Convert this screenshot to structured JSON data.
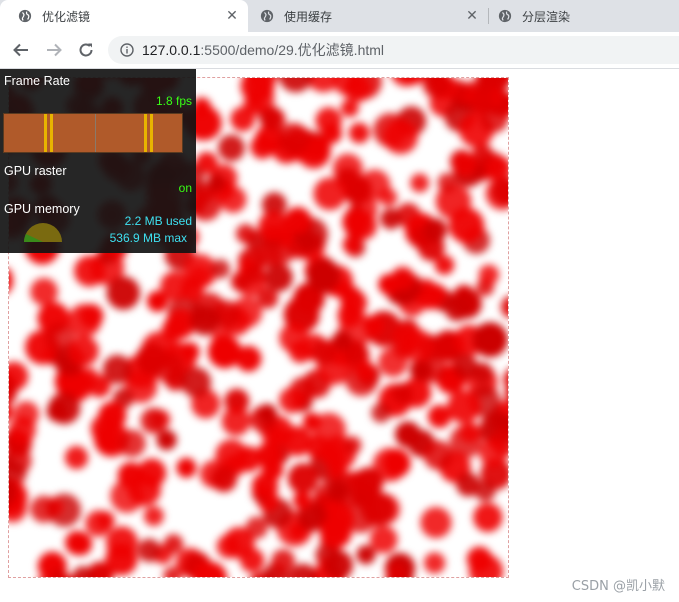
{
  "tabs": [
    {
      "title": "优化滤镜",
      "active": true
    },
    {
      "title": "使用缓存",
      "active": false
    },
    {
      "title": "分层渲染",
      "active": false
    }
  ],
  "toolbar": {
    "url_host": "127.0.0.1",
    "url_rest": ":5500/demo/29.优化滤镜.html",
    "icons": [
      "back-arrow-icon",
      "forward-arrow-icon",
      "reload-icon",
      "info-icon"
    ]
  },
  "hud": {
    "frame_rate_label": "Frame Rate",
    "fps_value": "1.8 fps",
    "gpu_raster_label": "GPU raster",
    "gpu_raster_value": "on",
    "gpu_memory_label": "GPU memory",
    "memory_used": "2.2 MB used",
    "memory_max": "536.9 MB max"
  },
  "colors": {
    "accent_green": "#39ff14",
    "accent_cyan": "#3ee0f0",
    "blob_red": "#ee0000"
  },
  "watermark": "CSDN @凯小默"
}
